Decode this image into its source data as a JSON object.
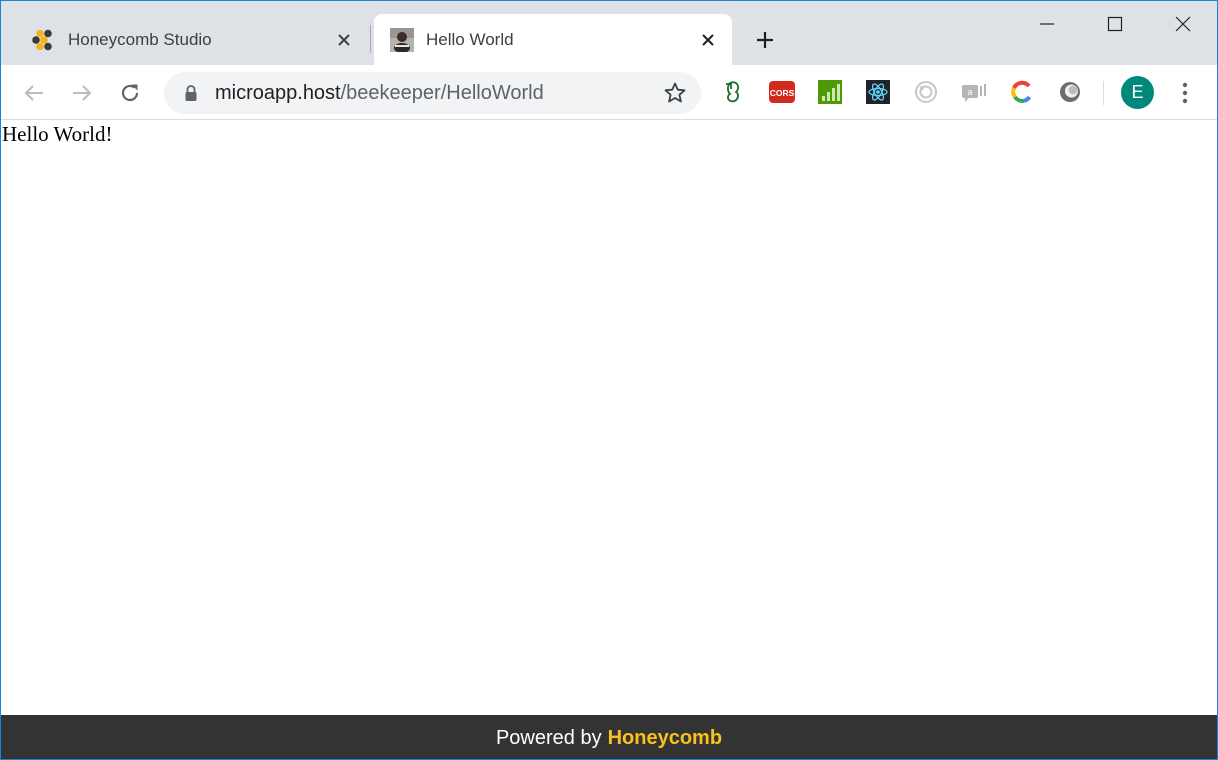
{
  "browser": {
    "tabs": [
      {
        "title": "Honeycomb Studio",
        "active": false,
        "favicon": "honeycomb-logo-icon"
      },
      {
        "title": "Hello World",
        "active": true,
        "favicon": "portrait-thumbnail-icon"
      }
    ],
    "address": {
      "host": "microapp.host",
      "path": "/beekeeper/HelloWorld"
    },
    "extensions": [
      "evernote-elephant-icon",
      "cors-icon",
      "bar-chart-icon",
      "react-devtools-icon",
      "ring-target-icon",
      "chat-bubble-icon",
      "colorful-c-icon",
      "gray-orb-icon"
    ],
    "profile_initial": "E",
    "colors": {
      "tabstrip": "#dee1e6",
      "omnibox": "#f1f3f4",
      "avatar": "#00897b",
      "footer_bg": "#333333",
      "brand": "#f7c21d"
    }
  },
  "page": {
    "text": "Hello World!"
  },
  "footer": {
    "prefix": "Powered by",
    "brand": "Honeycomb"
  }
}
